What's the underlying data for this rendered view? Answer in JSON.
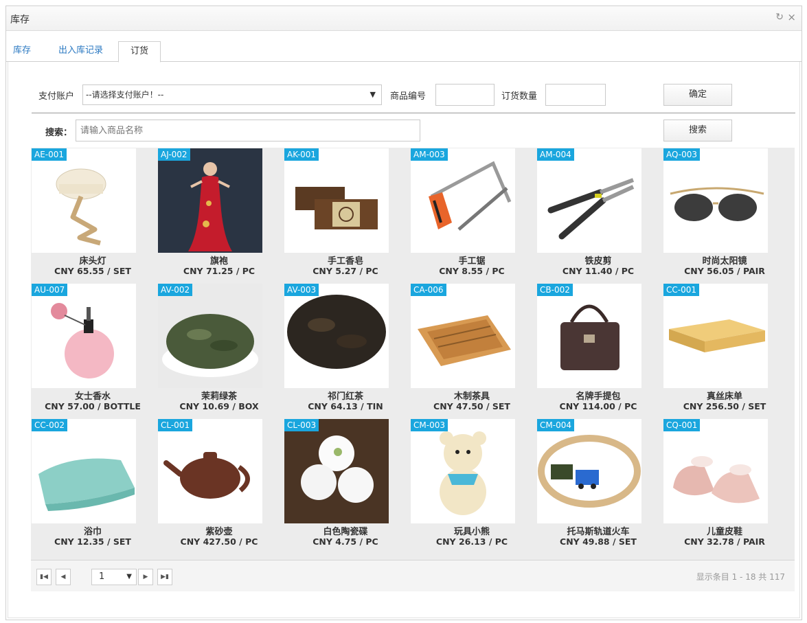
{
  "window": {
    "title": "库存"
  },
  "tabs": [
    {
      "label": "库存"
    },
    {
      "label": "出入库记录"
    },
    {
      "label": "订货"
    }
  ],
  "form": {
    "account_label": "支付账户",
    "account_selected": "--请选择支付账户！--",
    "product_no_label": "商品编号",
    "product_no_value": "",
    "quantity_label": "订货数量",
    "quantity_value": "",
    "confirm_label": "确定",
    "search_label": "搜索：",
    "search_placeholder": "请输入商品名称",
    "search_button": "搜索"
  },
  "products": [
    {
      "code": "AE-001",
      "name": "床头灯",
      "price": "CNY 65.55 / SET",
      "image": "lamp"
    },
    {
      "code": "AJ-002",
      "name": "旗袍",
      "price": "CNY 71.25 / PC",
      "image": "dress"
    },
    {
      "code": "AK-001",
      "name": "手工香皂",
      "price": "CNY 5.27 / PC",
      "image": "soap"
    },
    {
      "code": "AM-003",
      "name": "手工锯",
      "price": "CNY 8.55 / PC",
      "image": "saw"
    },
    {
      "code": "AM-004",
      "name": "铁皮剪",
      "price": "CNY 11.40 / PC",
      "image": "shears"
    },
    {
      "code": "AQ-003",
      "name": "时尚太阳镜",
      "price": "CNY 56.05 / PAIR",
      "image": "sunglasses"
    },
    {
      "code": "AU-007",
      "name": "女士香水",
      "price": "CNY 57.00 / BOTTLE",
      "image": "perfume"
    },
    {
      "code": "AV-002",
      "name": "茉莉绿茶",
      "price": "CNY 10.69 / BOX",
      "image": "greentea"
    },
    {
      "code": "AV-003",
      "name": "祁门红茶",
      "price": "CNY 64.13 / TIN",
      "image": "blacktea"
    },
    {
      "code": "CA-006",
      "name": "木制茶具",
      "price": "CNY 47.50 / SET",
      "image": "teatray"
    },
    {
      "code": "CB-002",
      "name": "名牌手提包",
      "price": "CNY 114.00 / PC",
      "image": "handbag"
    },
    {
      "code": "CC-001",
      "name": "真丝床单",
      "price": "CNY 256.50 / SET",
      "image": "sheet"
    },
    {
      "code": "CC-002",
      "name": "浴巾",
      "price": "CNY 12.35 / SET",
      "image": "towel"
    },
    {
      "code": "CL-001",
      "name": "紫砂壶",
      "price": "CNY 427.50 / PC",
      "image": "teapot"
    },
    {
      "code": "CL-003",
      "name": "白色陶瓷碟",
      "price": "CNY 4.75 / PC",
      "image": "plates"
    },
    {
      "code": "CM-003",
      "name": "玩具小熊",
      "price": "CNY 26.13 / PC",
      "image": "bear"
    },
    {
      "code": "CM-004",
      "name": "托马斯轨道火车",
      "price": "CNY 49.88 / SET",
      "image": "train"
    },
    {
      "code": "CQ-001",
      "name": "儿童皮鞋",
      "price": "CNY 32.78 / PAIR",
      "image": "shoes"
    }
  ],
  "pager": {
    "first_icon": "first-page-icon",
    "prev_icon": "prev-page-icon",
    "current_page": "1",
    "next_icon": "next-page-icon",
    "last_icon": "last-page-icon",
    "info": "显示条目 1 - 18 共 117"
  },
  "colors": {
    "accent": "#1aa6de",
    "tab_link": "#2b79c2"
  }
}
